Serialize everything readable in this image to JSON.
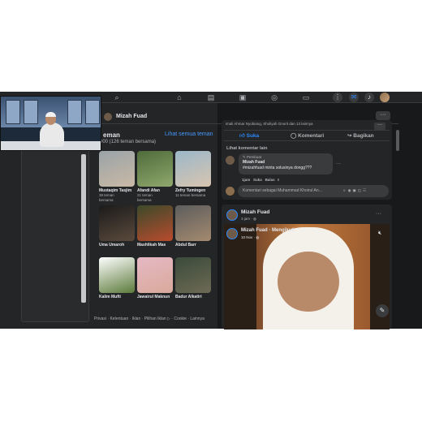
{
  "profile_name": "Mizah Fuad",
  "friends": {
    "title": "eman",
    "see_all": "Lihat semua teman",
    "count": "000 (126 teman bersama)",
    "items": [
      {
        "name": "Mustaqim Tasjim",
        "mutual": "38 teman\nbersama",
        "color1": "#9aa3a8",
        "color2": "#c9b9a5"
      },
      {
        "name": "Afandi Afan",
        "mutual": "21 teman\nbersama",
        "color1": "#4f6b3a",
        "color2": "#8fa86e"
      },
      {
        "name": "Zefry Tumingen",
        "mutual": "11 teman bersama",
        "color1": "#9bb7c9",
        "color2": "#d8c5b0"
      },
      {
        "name": "Uma Umaroh",
        "mutual": "",
        "color1": "#1b1b1b",
        "color2": "#5b4a3c"
      },
      {
        "name": "Mashlikah Mas",
        "mutual": "",
        "color1": "#3b4a2a",
        "color2": "#b94b2e"
      },
      {
        "name": "Abdul Barr",
        "mutual": "",
        "color1": "#5d5d5d",
        "color2": "#a48a6f"
      },
      {
        "name": "Kalim Mufti",
        "mutual": "",
        "color1": "#ffffff",
        "color2": "#5b7a3a"
      },
      {
        "name": "Jawairul Maknun",
        "mutual": "",
        "color1": "#e6b9c5",
        "color2": "#d8a99a"
      },
      {
        "name": "Badur Alkatiri",
        "mutual": "",
        "color1": "#3a4a3a",
        "color2": "#6d6a55"
      }
    ]
  },
  "footer": "Privasi · Ketentuan · Iklan · Pilihan Iklan ▷ · Cookie · Lainnya",
  "post1": {
    "truncated_top": "imali Ahmar Nyobiang, Sholiyah Gnorit dan 13 lainnya",
    "like": "Suka",
    "comment": "Komentari",
    "share": "Bagikan",
    "see_other_comments": "Lihat komentar lain",
    "badge": "Pembuat",
    "commenter": "Mizah Fuad",
    "comment_text": "#mizahfuad minta solusinya dongg???",
    "comment_time": "1jam",
    "comment_like": "Suka",
    "comment_reply": "Balas",
    "comment_placeholder": "Komentari sebagai Muhammad Khoirul An..."
  },
  "post2": {
    "name": "Mizah Fuad",
    "time": "3 jam · ",
    "shared_name": "Mizah Fuad · Mengikuti",
    "shared_time": "10 Nov · "
  },
  "colors": {
    "bg": "#18191a",
    "card": "#242526",
    "link": "#4599ff",
    "like": "#2d88ff"
  }
}
